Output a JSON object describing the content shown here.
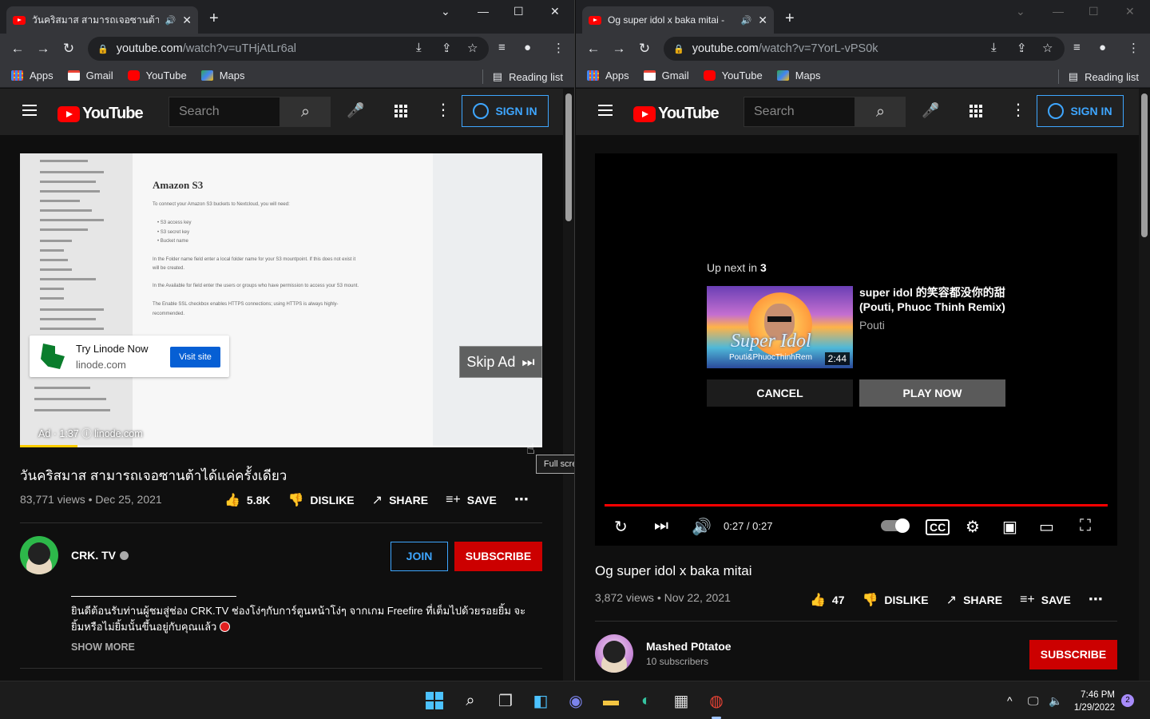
{
  "left_window": {
    "tab": {
      "title": "วันคริสมาส สามารถเจอซานต้าได้แ..."
    },
    "url": {
      "host": "youtube.com",
      "path": "/watch?v=uTHjAtLr6al"
    },
    "bookmarks": [
      {
        "label": "Apps",
        "icon": "apps-grid-icon"
      },
      {
        "label": "Gmail",
        "icon": "gmail-icon"
      },
      {
        "label": "YouTube",
        "icon": "youtube-icon"
      },
      {
        "label": "Maps",
        "icon": "maps-icon"
      }
    ],
    "reading_list": "Reading list",
    "masthead": {
      "logo_text": "YouTube",
      "search_placeholder": "Search",
      "sign_in": "SIGN IN"
    },
    "ad": {
      "doc_heading": "Amazon S3",
      "doc_lines": [
        "To connect your Amazon S3 buckets to Nextcloud, you will need:",
        "• S3 access key",
        "• S3 secret key",
        "• Bucket name",
        "In the Folder name field enter a local folder name for your S3 mountpoint. If this does not exist it",
        "will be created.",
        "In the Available for field enter the users or groups who have permission to access your S3 mount.",
        "The Enable SSL checkbox enables HTTPS connections; using HTTPS is always highly-",
        "recommended."
      ],
      "advertiser": "Try Linode Now",
      "domain": "linode.com",
      "visit_label": "Visit site",
      "skip_label": "Skip Ad",
      "ad_timer": "Ad · 1:37",
      "ad_domain": "linode.com",
      "progress": 0.11
    },
    "tooltip": "Full screen (f)",
    "video": {
      "title": "วันคริสมาส สามารถเจอซานต้าได้แค่ครั้งเดียว",
      "meta": "83,771 views • Dec 25, 2021",
      "likes": "5.8K",
      "dislike": "DISLIKE",
      "share": "SHARE",
      "save": "SAVE"
    },
    "channel": {
      "name": "CRK. TV",
      "join": "JOIN",
      "subscribe": "SUBSCRIBE"
    },
    "description": {
      "line1": "ยินดีต้อนรับท่านผู้ชมสู่ช่อง CRK.TV ช่องโง่ๆกับการ์ตูนหน้าโง่ๆ จากเกม Freefire ที่เต็มไปด้วยรอยยิ้ม จะ",
      "line2": "ยิ้มหรือไม่ยิ้มนั้นขึ้นอยู่กับคุณแล้ว",
      "show_more": "SHOW MORE"
    }
  },
  "right_window": {
    "tab": {
      "title": "Og super idol x baka mitai -"
    },
    "url": {
      "host": "youtube.com",
      "path": "/watch?v=7YorL-vPS0k"
    },
    "bookmarks": [
      {
        "label": "Apps",
        "icon": "apps-grid-icon"
      },
      {
        "label": "Gmail",
        "icon": "gmail-icon"
      },
      {
        "label": "YouTube",
        "icon": "youtube-icon"
      },
      {
        "label": "Maps",
        "icon": "maps-icon"
      }
    ],
    "reading_list": "Reading list",
    "masthead": {
      "logo_text": "YouTube",
      "search_placeholder": "Search",
      "sign_in": "SIGN IN"
    },
    "upnext": {
      "label": "Up next in",
      "countdown": "3",
      "title": "super idol 的笑容都没你的甜 (Pouti, Phuoc Thinh Remix)",
      "channel": "Pouti",
      "thumb_text": "Super Idol",
      "thumb_sub": "Pouti&PhuocThinhRem",
      "duration": "2:44",
      "cancel": "CANCEL",
      "play_now": "PLAY NOW"
    },
    "player": {
      "time": "0:27 / 0:27",
      "progress": 1.0
    },
    "video": {
      "title": "Og super idol x baka mitai",
      "meta": "3,872 views • Nov 22, 2021",
      "likes": "47",
      "dislike": "DISLIKE",
      "share": "SHARE",
      "save": "SAVE"
    },
    "channel": {
      "name": "Mashed P0tatoe",
      "subscribers": "10 subscribers",
      "subscribe": "SUBSCRIBE"
    }
  },
  "taskbar": {
    "apps": [
      "windows-start-icon",
      "search-icon",
      "task-view-icon",
      "widgets-icon",
      "teams-chat-icon",
      "file-explorer-icon",
      "edge-icon",
      "store-icon",
      "chrome-icon"
    ],
    "time": "7:46 PM",
    "date": "1/29/2022",
    "notifications": "2"
  },
  "colors": {
    "accent": "#3ea6ff",
    "subscribe": "#cc0000",
    "youtube_red": "#ff0000",
    "background": "#0f0f0f"
  }
}
